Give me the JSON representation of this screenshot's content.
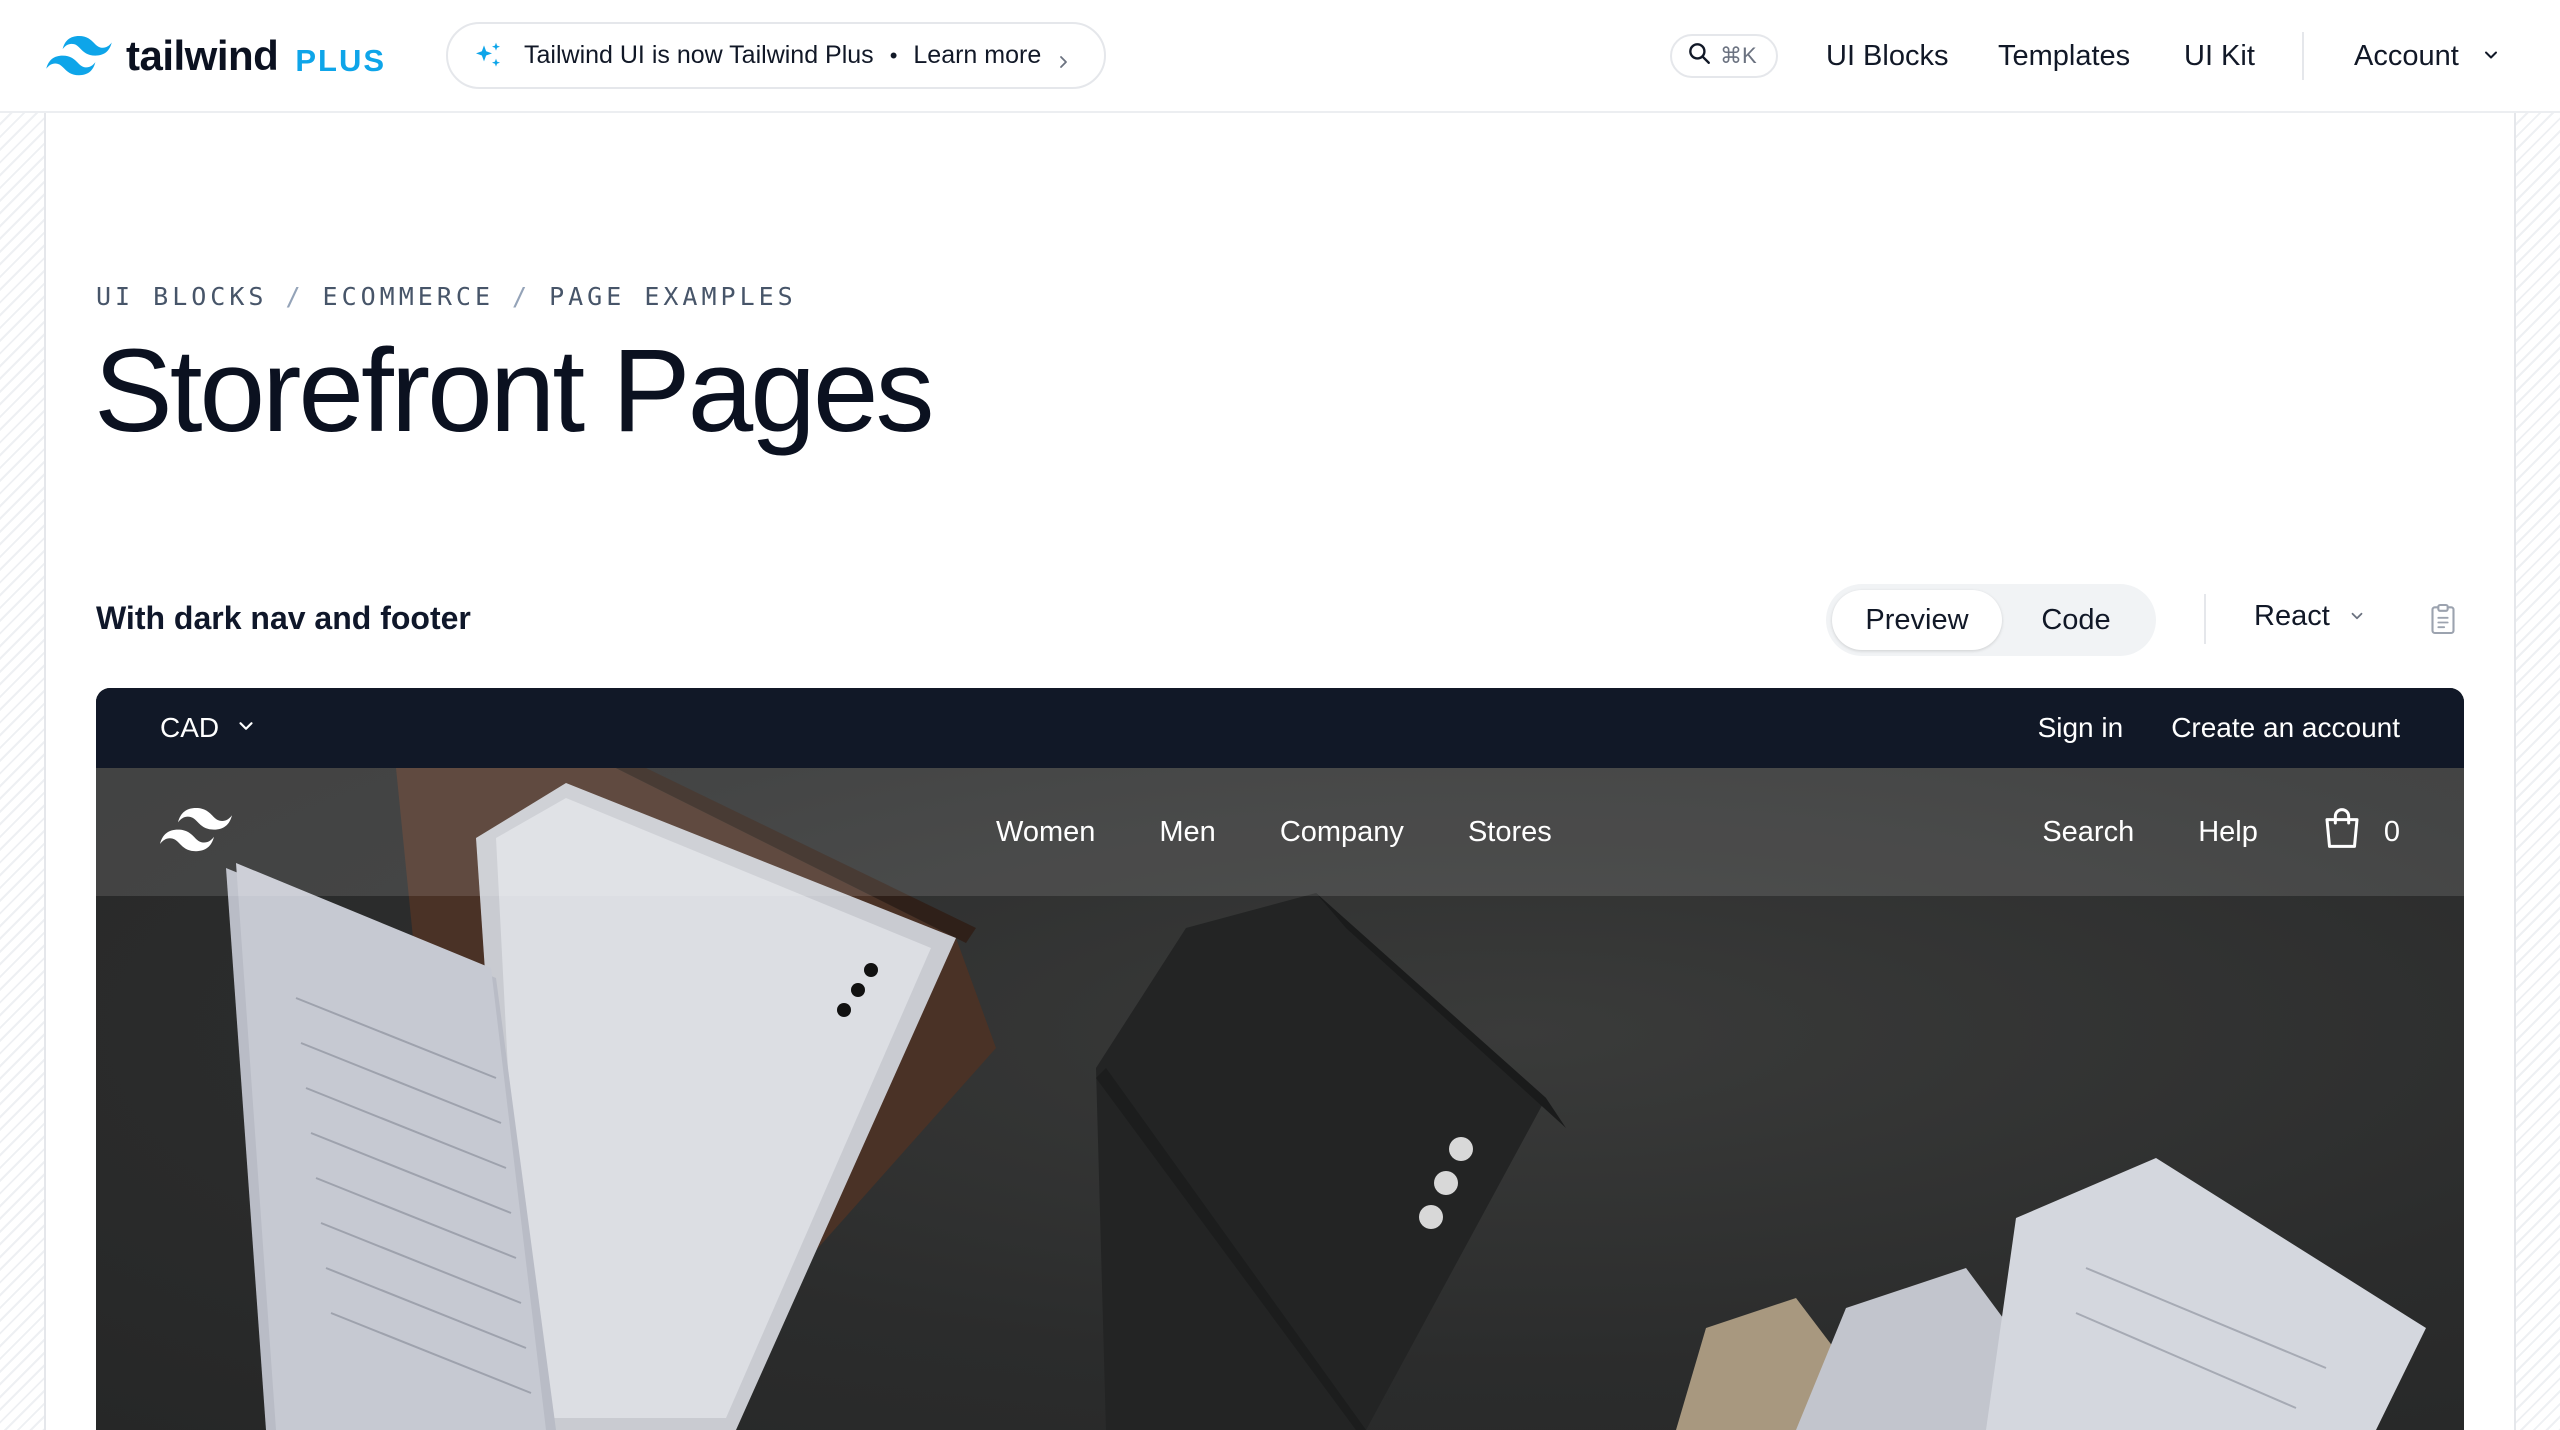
{
  "header": {
    "brand": "tailwind",
    "brand_suffix": "PLUS",
    "announcement": {
      "text": "Tailwind UI is now Tailwind Plus",
      "separator": "•",
      "link": "Learn more"
    },
    "search_shortcut": "⌘K",
    "nav": {
      "ui_blocks": "UI Blocks",
      "templates": "Templates",
      "ui_kit": "UI Kit",
      "account": "Account"
    }
  },
  "breadcrumb": {
    "items": [
      "UI BLOCKS",
      "ECOMMERCE",
      "PAGE EXAMPLES"
    ],
    "separator": "/"
  },
  "page": {
    "title": "Storefront Pages"
  },
  "example": {
    "title": "With dark nav and footer",
    "view_toggle": {
      "preview": "Preview",
      "code": "Code",
      "selected": "Preview"
    },
    "framework": "React"
  },
  "preview": {
    "promo_bar": {
      "currency": "CAD",
      "sign_in": "Sign in",
      "create_account": "Create an account"
    },
    "store_nav": {
      "links": [
        "Women",
        "Men",
        "Company",
        "Stores"
      ],
      "search": "Search",
      "help": "Help",
      "cart_count": "0"
    }
  },
  "colors": {
    "brand_blue": "#0ea5e9",
    "promo_bg": "#111827",
    "text_dark": "#0b1120"
  },
  "icons": [
    "tailwind-logo-icon",
    "sparkles-icon",
    "chevron-right-icon",
    "search-icon",
    "chevron-down-icon",
    "clipboard-icon",
    "shopping-bag-icon"
  ]
}
